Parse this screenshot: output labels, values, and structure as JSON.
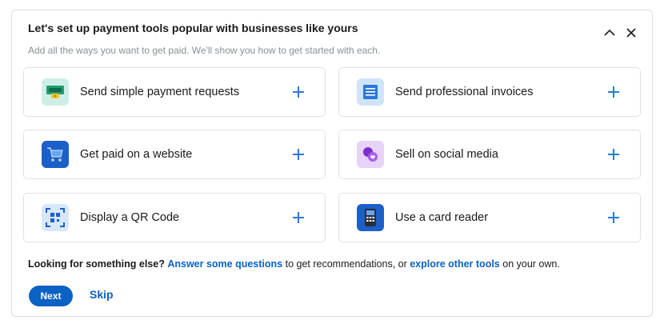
{
  "header": {
    "title": "Let's set up payment tools popular with businesses like yours",
    "subtitle": "Add all the ways you want to get paid. We'll show you how to get started with each."
  },
  "tools": [
    {
      "label": "Send simple payment requests",
      "icon": "payment-request-icon"
    },
    {
      "label": "Send professional invoices",
      "icon": "invoice-icon"
    },
    {
      "label": "Get paid on a website",
      "icon": "shopping-cart-icon"
    },
    {
      "label": "Sell on social media",
      "icon": "social-media-icon"
    },
    {
      "label": "Display a QR Code",
      "icon": "qr-code-icon"
    },
    {
      "label": "Use a card reader",
      "icon": "card-reader-icon"
    }
  ],
  "footer": {
    "prefix": "Looking for something else?",
    "link1": "Answer some questions",
    "middle": " to get recommendations, or ",
    "link2": "explore other tools",
    "suffix": " on your own."
  },
  "actions": {
    "next_label": "Next",
    "skip_label": "Skip"
  },
  "colors": {
    "accent": "#0b62c4",
    "plus": "#2a7ad6",
    "border": "#dfe3e7"
  }
}
